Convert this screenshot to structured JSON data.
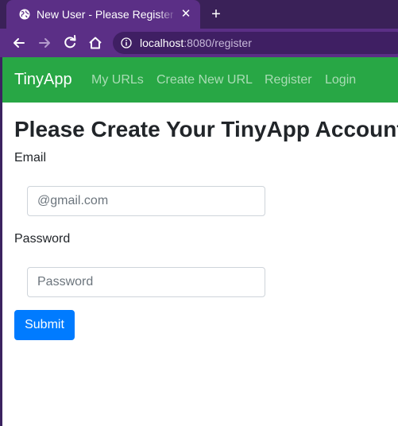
{
  "browser": {
    "tab_title": "New User - Please Register",
    "url_host": "localhost",
    "url_rest": ":8080/register",
    "colors": {
      "frame": "#3a2158",
      "toolbar": "#5b2f86",
      "address_bar": "#3f1f63"
    }
  },
  "navbar": {
    "brand": "TinyApp",
    "links": [
      "My URLs",
      "Create New URL",
      "Register",
      "Login"
    ],
    "color": "#28a745"
  },
  "form": {
    "heading": "Please Create Your TinyApp Account",
    "email_label": "Email",
    "email_placeholder": "@gmail.com",
    "password_label": "Password",
    "password_placeholder": "Password",
    "submit_label": "Submit",
    "submit_color": "#007bff"
  }
}
